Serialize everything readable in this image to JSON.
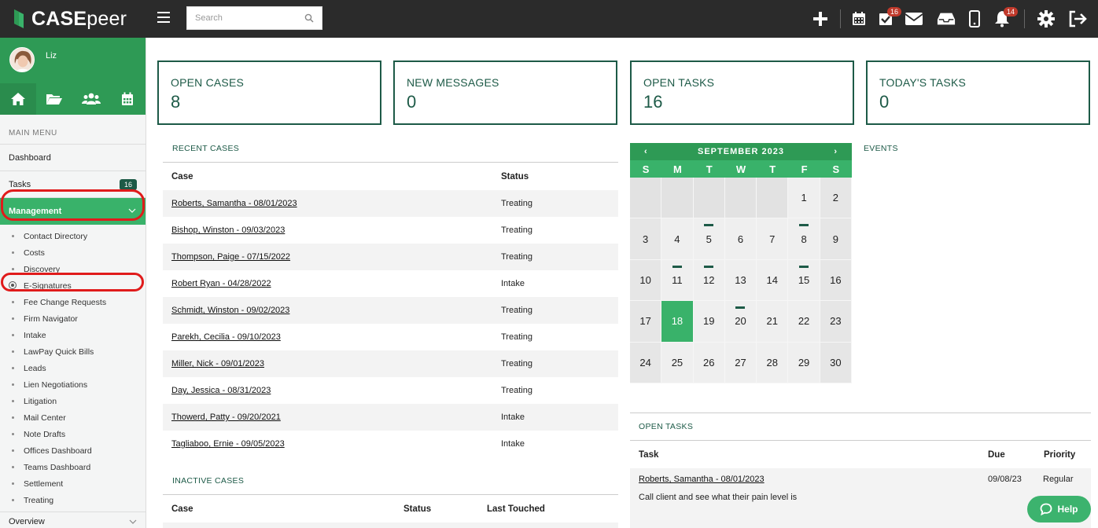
{
  "app": {
    "logo_text_a": "CASE",
    "logo_text_b": "peer"
  },
  "search": {
    "placeholder": "Search"
  },
  "topbar": {
    "badges": {
      "tasks": "16",
      "notifications": "14"
    },
    "icons": [
      "plus-icon",
      "calendar-icon",
      "tasks-check-icon",
      "mail-icon",
      "inbox-icon",
      "mobile-icon",
      "bell-icon",
      "gear-icon",
      "logout-icon"
    ]
  },
  "sidebar": {
    "user_name": "Liz",
    "section_label": "MAIN MENU",
    "dashboard": "Dashboard",
    "tasks": "Tasks",
    "tasks_badge": "16",
    "management": "Management",
    "management_items": [
      "Contact Directory",
      "Costs",
      "Discovery",
      "E-Signatures",
      "Fee Change Requests",
      "Firm Navigator",
      "Intake",
      "LawPay Quick Bills",
      "Leads",
      "Lien Negotiations",
      "Litigation",
      "Mail Center",
      "Note Drafts",
      "Offices Dashboard",
      "Teams Dashboard",
      "Settlement",
      "Treating"
    ],
    "overview": "Overview"
  },
  "stats": [
    {
      "label": "OPEN CASES",
      "value": "8"
    },
    {
      "label": "NEW MESSAGES",
      "value": "0"
    },
    {
      "label": "OPEN TASKS",
      "value": "16"
    },
    {
      "label": "TODAY'S TASKS",
      "value": "0"
    }
  ],
  "recent_cases": {
    "title": "RECENT CASES",
    "columns": [
      "Case",
      "Status"
    ],
    "rows": [
      {
        "case": "Roberts, Samantha - 08/01/2023",
        "status": "Treating"
      },
      {
        "case": "Bishop, Winston - 09/03/2023",
        "status": "Treating"
      },
      {
        "case": "Thompson, Paige - 07/15/2022",
        "status": "Treating"
      },
      {
        "case": "Robert Ryan - 04/28/2022",
        "status": "Intake"
      },
      {
        "case": "Schmidt, Winston - 09/02/2023",
        "status": "Treating"
      },
      {
        "case": "Parekh, Cecilia - 09/10/2023",
        "status": "Treating"
      },
      {
        "case": "Miller, Nick - 09/01/2023",
        "status": "Treating"
      },
      {
        "case": "Day, Jessica - 08/31/2023",
        "status": "Treating"
      },
      {
        "case": "Thowerd, Patty - 09/20/2021",
        "status": "Intake"
      },
      {
        "case": "Tagliaboo, Ernie - 09/05/2023",
        "status": "Intake"
      }
    ]
  },
  "inactive_cases": {
    "title": "INACTIVE CASES",
    "columns": [
      "Case",
      "Status",
      "Last Touched"
    ]
  },
  "calendar": {
    "month": "SEPTEMBER 2023",
    "prev": "‹",
    "next": "›",
    "dow": [
      "S",
      "M",
      "T",
      "W",
      "T",
      "F",
      "S"
    ],
    "weeks": [
      [
        "",
        "",
        "",
        "",
        "",
        "1",
        "2"
      ],
      [
        "3",
        "4",
        "5",
        "6",
        "7",
        "8",
        "9"
      ],
      [
        "10",
        "11",
        "12",
        "13",
        "14",
        "15",
        "16"
      ],
      [
        "17",
        "18",
        "19",
        "20",
        "21",
        "22",
        "23"
      ],
      [
        "24",
        "25",
        "26",
        "27",
        "28",
        "29",
        "30"
      ]
    ],
    "today": "18",
    "event_days": [
      "5",
      "8",
      "11",
      "12",
      "15",
      "20"
    ]
  },
  "events": {
    "title": "EVENTS"
  },
  "open_tasks": {
    "title": "OPEN TASKS",
    "columns": [
      "Task",
      "Due",
      "Priority"
    ],
    "rows": [
      {
        "task": "Roberts, Samantha - 08/01/2023",
        "due": "09/08/23",
        "priority": "Regular",
        "note": "Call client and see what their pain level is"
      }
    ]
  },
  "help": {
    "label": "Help"
  },
  "colors": {
    "brand_green": "#39b26a",
    "dark_green": "#1d5a47",
    "topbar": "#2b2b2b",
    "highlight_ring": "#e01b1b"
  }
}
